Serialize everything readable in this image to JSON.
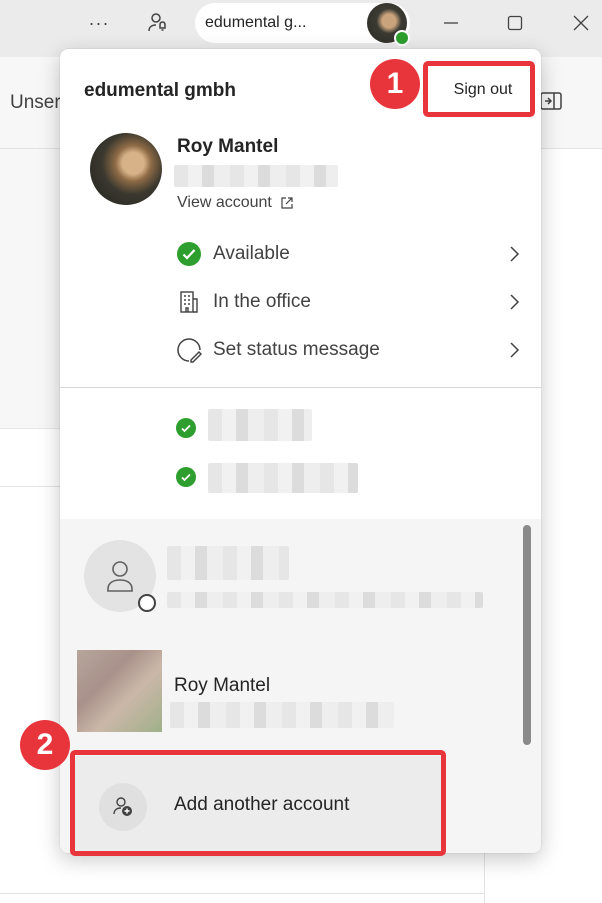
{
  "titlebar": {
    "more_label": "···",
    "account_pill_text": "edumental g...",
    "icons": [
      "more-icon",
      "people-bell-icon",
      "minimize-icon",
      "maximize-icon",
      "close-icon"
    ]
  },
  "app": {
    "left_label": "Unser"
  },
  "flyout": {
    "org_name": "edumental gmbh",
    "sign_out_label": "Sign out",
    "profile": {
      "name": "Roy Mantel",
      "view_account_label": "View account"
    },
    "status_items": [
      {
        "label": "Available",
        "icon": "available-check-icon"
      },
      {
        "label": "In the office",
        "icon": "building-icon"
      },
      {
        "label": "Set status message",
        "icon": "edit-status-icon"
      }
    ],
    "other_accounts": [
      {
        "name": "Roy Mantel"
      }
    ],
    "add_account_label": "Add another account"
  },
  "annotations": {
    "badge_1": "1",
    "badge_2": "2"
  },
  "colors": {
    "annotation_red": "#e8353c",
    "presence_green": "#2e9e2e",
    "titlebar_bg": "#ebebeb"
  }
}
